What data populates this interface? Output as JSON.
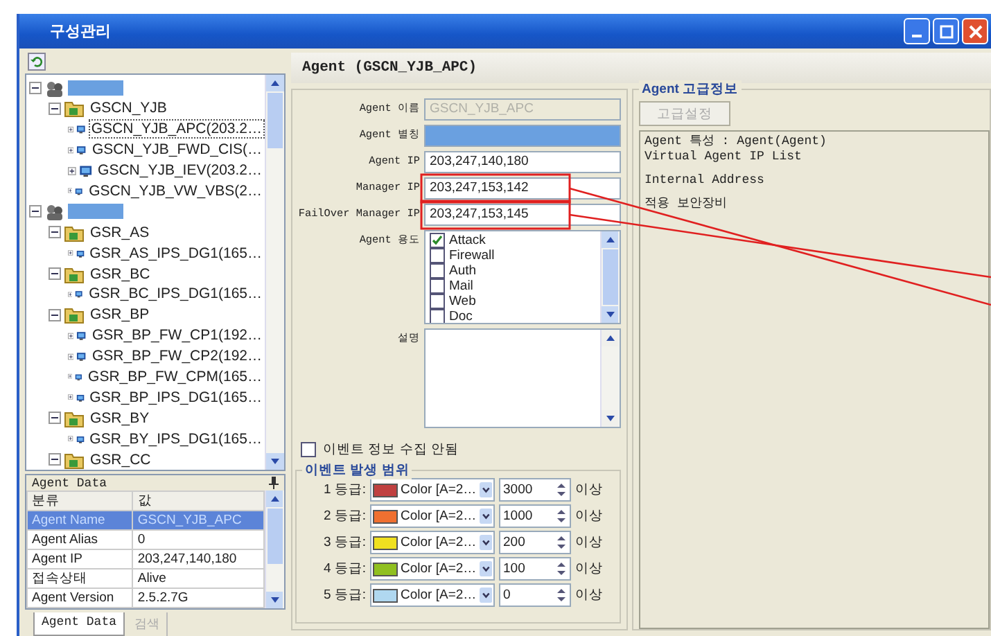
{
  "window": {
    "title": "구성관리"
  },
  "tree": [
    {
      "kind": "group",
      "redacted": true,
      "expanded": true,
      "children": [
        {
          "kind": "folder",
          "label": "GSCN_YJB",
          "expanded": true,
          "selected": false,
          "children": [
            {
              "kind": "agent",
              "label": "GSCN_YJB_APC(203.2…",
              "expanded": false,
              "selected": true
            },
            {
              "kind": "agent",
              "label": "GSCN_YJB_FWD_CIS(…",
              "expanded": false,
              "selected": false
            },
            {
              "kind": "agent",
              "label": "GSCN_YJB_IEV(203.2…",
              "expanded": false,
              "selected": false
            },
            {
              "kind": "agent",
              "label": "GSCN_YJB_VW_VBS(2…",
              "expanded": false,
              "selected": false
            }
          ]
        }
      ]
    },
    {
      "kind": "group",
      "redacted": true,
      "expanded": true,
      "children": [
        {
          "kind": "folder",
          "label": "GSR_AS",
          "expanded": true,
          "selected": false,
          "children": [
            {
              "kind": "agent",
              "label": "GSR_AS_IPS_DG1(165…",
              "expanded": false,
              "selected": false
            }
          ]
        },
        {
          "kind": "folder",
          "label": "GSR_BC",
          "expanded": true,
          "selected": false,
          "children": [
            {
              "kind": "agent",
              "label": "GSR_BC_IPS_DG1(165…",
              "expanded": false,
              "selected": false
            }
          ]
        },
        {
          "kind": "folder",
          "label": "GSR_BP",
          "expanded": true,
          "selected": false,
          "children": [
            {
              "kind": "agent",
              "label": "GSR_BP_FW_CP1(192…",
              "expanded": false,
              "selected": false
            },
            {
              "kind": "agent",
              "label": "GSR_BP_FW_CP2(192…",
              "expanded": false,
              "selected": false
            },
            {
              "kind": "agent",
              "label": "GSR_BP_FW_CPM(165…",
              "expanded": false,
              "selected": false
            },
            {
              "kind": "agent",
              "label": "GSR_BP_IPS_DG1(165…",
              "expanded": false,
              "selected": false
            }
          ]
        },
        {
          "kind": "folder",
          "label": "GSR_BY",
          "expanded": true,
          "selected": false,
          "children": [
            {
              "kind": "agent",
              "label": "GSR_BY_IPS_DG1(165…",
              "expanded": false,
              "selected": false
            }
          ]
        },
        {
          "kind": "folder",
          "label": "GSR_CC",
          "expanded": true,
          "selected": false
        }
      ]
    }
  ],
  "agent_data": {
    "title": "Agent Data",
    "columns": [
      "분류",
      "값"
    ],
    "rows": [
      {
        "name": "Agent Name",
        "value": "GSCN_YJB_APC",
        "selected": true
      },
      {
        "name": "Agent Alias",
        "value": "0",
        "selected": false
      },
      {
        "name": "Agent IP",
        "value": "203,247,140,180",
        "selected": false
      },
      {
        "name": "접속상태",
        "value": "Alive",
        "selected": false
      },
      {
        "name": "Agent Version",
        "value": "2.5.2.7G",
        "selected": false
      }
    ]
  },
  "bottom_tabs": [
    {
      "label": "Agent Data",
      "selected": true
    },
    {
      "label": "검색",
      "selected": false
    }
  ],
  "header": "Agent (GSCN_YJB_APC)",
  "fields": [
    {
      "label": "Agent 이름",
      "value": "GSCN_YJB_APC",
      "disabled": true,
      "redacted": false,
      "highlighted": false
    },
    {
      "label": "Agent 별칭",
      "disabled": false,
      "redacted": true,
      "highlighted": false
    },
    {
      "label": "Agent IP",
      "value": "203,247,140,180",
      "disabled": false,
      "redacted": false,
      "highlighted": false
    },
    {
      "label": "Manager IP",
      "value": "203,247,153,142",
      "disabled": false,
      "redacted": false,
      "highlighted": true
    },
    {
      "label": "FailOver Manager IP",
      "value": "203,247,153,145",
      "disabled": false,
      "redacted": false,
      "highlighted": true
    }
  ],
  "usage": {
    "label": "Agent 용도",
    "items": [
      {
        "label": "Attack",
        "checked": true
      },
      {
        "label": "Firewall",
        "checked": false
      },
      {
        "label": "Auth",
        "checked": false
      },
      {
        "label": "Mail",
        "checked": false
      },
      {
        "label": "Web",
        "checked": false
      },
      {
        "label": "Doc",
        "checked": false
      }
    ]
  },
  "description": {
    "label": "설명"
  },
  "no_collect": {
    "label": "이벤트 정보 수집 안됨",
    "checked": false
  },
  "event_range": {
    "title": "이벤트 발생 범위",
    "levels": [
      {
        "label": "1 등급:",
        "color": "#c04040",
        "color_text": "Color [A=2…",
        "value": "3000",
        "suffix": "이상"
      },
      {
        "label": "2 등급:",
        "color": "#f07030",
        "color_text": "Color [A=2…",
        "value": "1000",
        "suffix": "이상"
      },
      {
        "label": "3 등급:",
        "color": "#f0e020",
        "color_text": "Color [A=2…",
        "value": "200",
        "suffix": "이상"
      },
      {
        "label": "4 등급:",
        "color": "#90c020",
        "color_text": "Color [A=2…",
        "value": "100",
        "suffix": "이상"
      },
      {
        "label": "5 등급:",
        "color": "#b0d8f0",
        "color_text": "Color [A=2…",
        "value": "0",
        "suffix": "이상"
      }
    ]
  },
  "advanced": {
    "title": "Agent 고급정보",
    "button": "고급설정",
    "lines": [
      "Agent 특성 : Agent(Agent)",
      "Virtual Agent IP List",
      "Internal Address",
      "적용 보안장비"
    ]
  }
}
